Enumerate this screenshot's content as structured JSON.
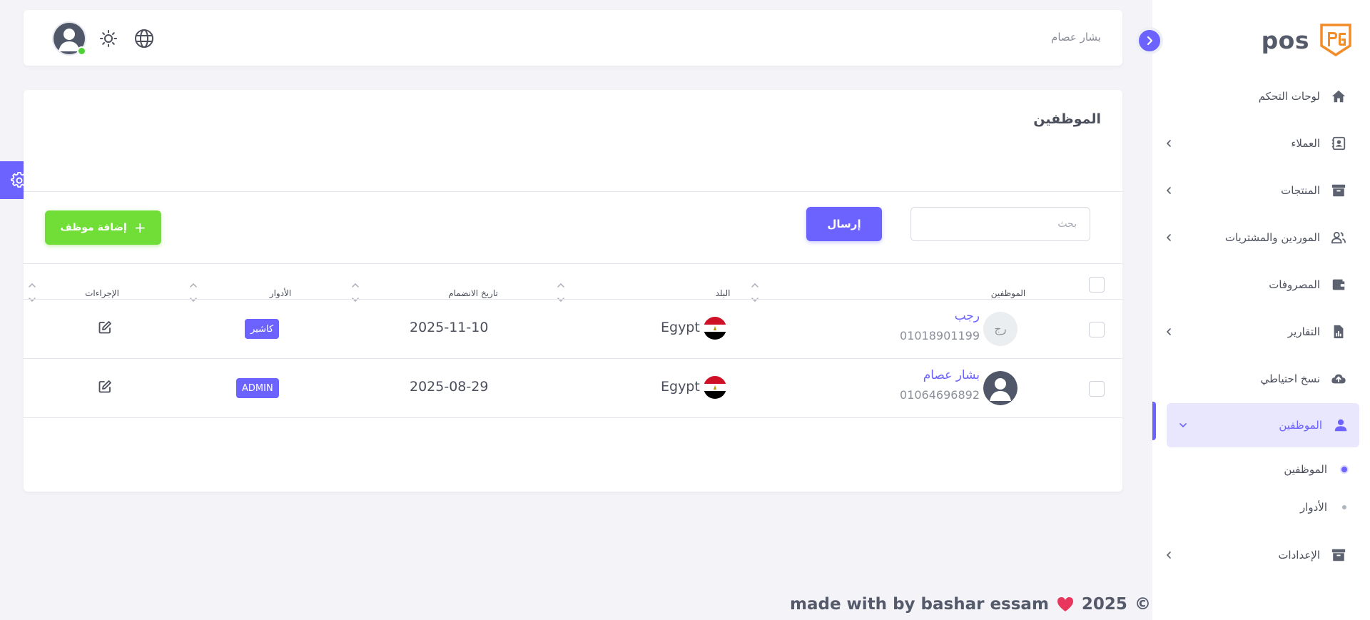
{
  "brand": {
    "name": "pos",
    "logo_text": "PG",
    "logo_color": "#f28c28"
  },
  "colors": {
    "primary": "#6c63ff",
    "success": "#71dd37",
    "online": "#4cd137"
  },
  "header": {
    "user_name": "بشار عصام",
    "icons": [
      "globe-icon",
      "sun-icon"
    ]
  },
  "sidebar": {
    "items": [
      {
        "label": "لوحات التحكم",
        "icon": "home-icon",
        "has_children": false
      },
      {
        "label": "العملاء",
        "icon": "contacts-icon",
        "has_children": true
      },
      {
        "label": "المنتجات",
        "icon": "archive-icon",
        "has_children": true
      },
      {
        "label": "الموردين والمشتريات",
        "icon": "users-icon",
        "has_children": true
      },
      {
        "label": "المصروفات",
        "icon": "wallet-icon",
        "has_children": false
      },
      {
        "label": "التقارير",
        "icon": "report-icon",
        "has_children": true
      },
      {
        "label": "نسخ احتياطي",
        "icon": "cloud-upload-icon",
        "has_children": false
      },
      {
        "label": "الموظفين",
        "icon": "user-icon",
        "has_children": true,
        "active": true
      },
      {
        "label": "الإعدادات",
        "icon": "archive-icon",
        "has_children": true
      }
    ],
    "sub_items": [
      {
        "label": "الموظفين",
        "active": true
      },
      {
        "label": "الأدوار",
        "active": false
      }
    ]
  },
  "page": {
    "title": "الموظفين",
    "search_placeholder": "بحث",
    "send_label": "إرسال",
    "add_label": "إضافة موظف"
  },
  "table": {
    "columns": [
      "الموظفين",
      "البلد",
      "تاريخ الانضمام",
      "الأدوار",
      "الإجراءات"
    ],
    "rows": [
      {
        "initials": "رج",
        "name": "رجب",
        "phone": "01018901199",
        "country": "Egypt",
        "joined": "2025-11-10",
        "role": "كاشير",
        "avatar_type": "initials"
      },
      {
        "initials": "",
        "name": "بشار عصام",
        "phone": "01064696892",
        "country": "Egypt",
        "joined": "2025-08-29",
        "role": "ADMIN",
        "avatar_type": "photo"
      }
    ]
  },
  "footer": {
    "prefix": "made with by bashar essam",
    "year": "2025",
    "symbol": "©"
  }
}
